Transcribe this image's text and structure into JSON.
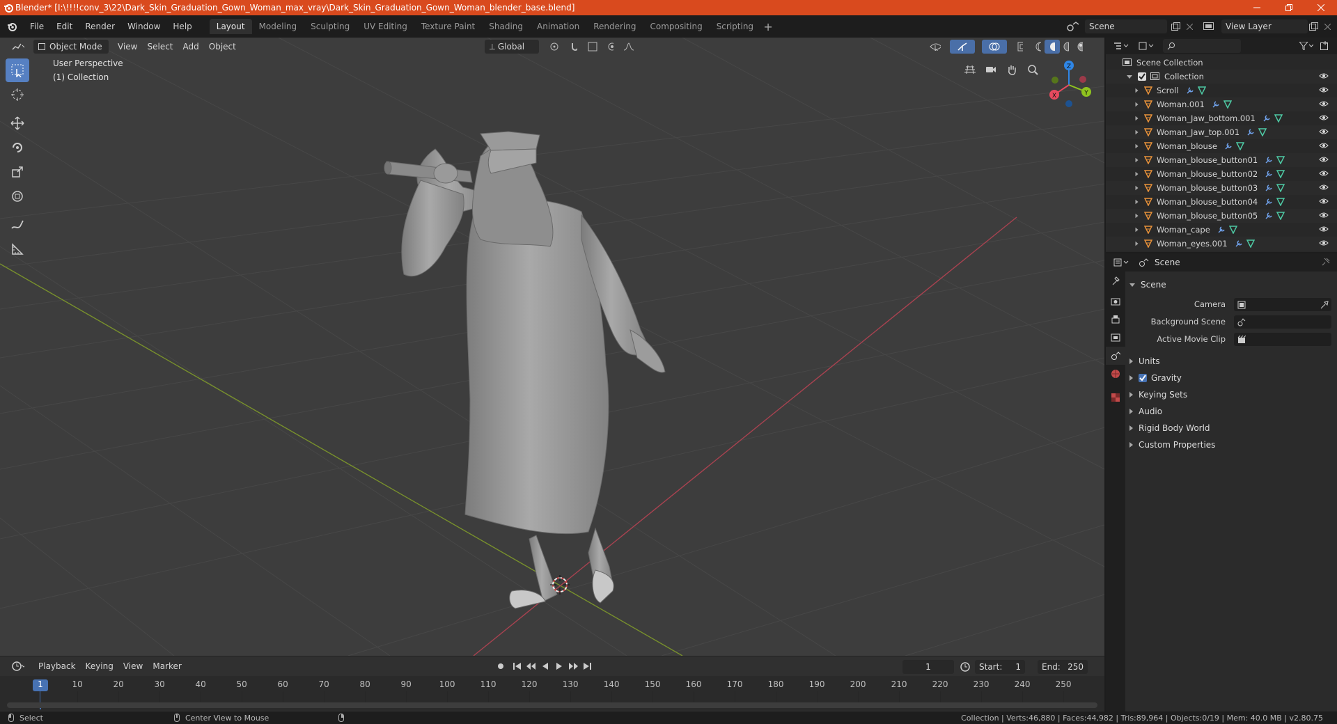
{
  "window": {
    "title": "Blender* [I:\\!!!!conv_3\\22\\Dark_Skin_Graduation_Gown_Woman_max_vray\\Dark_Skin_Graduation_Gown_Woman_blender_base.blend]",
    "accent": "#d94a1e"
  },
  "menu": {
    "items": [
      "File",
      "Edit",
      "Render",
      "Window",
      "Help"
    ]
  },
  "workspaces": {
    "tabs": [
      "Layout",
      "Modeling",
      "Sculpting",
      "UV Editing",
      "Texture Paint",
      "Shading",
      "Animation",
      "Rendering",
      "Compositing",
      "Scripting"
    ],
    "active": "Layout",
    "add_icon": "plus-icon"
  },
  "scene_selector": {
    "value": "Scene"
  },
  "view_layer_selector": {
    "value": "View Layer"
  },
  "viewport": {
    "mode": "Object Mode",
    "menus": [
      "View",
      "Select",
      "Add",
      "Object"
    ],
    "transform_orientation": "Global",
    "perspective_label": "User Perspective",
    "collection_label": "(1) Collection",
    "gizmo_axes": [
      "X",
      "Y",
      "Z"
    ],
    "colors": {
      "x_axis": "#e84a5f",
      "y_axis": "#8fc31f",
      "z_axis": "#2f86e6",
      "grid_bg": "#3d3d3d"
    }
  },
  "timeline": {
    "menus": [
      "Playback",
      "Keying",
      "View",
      "Marker"
    ],
    "current_frame": "1",
    "start_label": "Start:",
    "start_value": "1",
    "end_label": "End:",
    "end_value": "250",
    "ruler": [
      "1",
      "10",
      "20",
      "30",
      "40",
      "50",
      "60",
      "70",
      "80",
      "90",
      "100",
      "110",
      "120",
      "130",
      "140",
      "150",
      "160",
      "170",
      "180",
      "190",
      "200",
      "210",
      "220",
      "230",
      "240",
      "250"
    ]
  },
  "statusbar": {
    "left_action": "Select",
    "middle_action": "Center View to Mouse",
    "stats": "Collection | Verts:46,880 | Faces:44,982 | Tris:89,964 | Objects:0/19 | Mem: 40.0 MB | v2.80.75"
  },
  "outliner": {
    "root": "Scene Collection",
    "collection": "Collection",
    "items": [
      "Scroll",
      "Woman.001",
      "Woman_Jaw_bottom.001",
      "Woman_Jaw_top.001",
      "Woman_blouse",
      "Woman_blouse_button01",
      "Woman_blouse_button02",
      "Woman_blouse_button03",
      "Woman_blouse_button04",
      "Woman_blouse_button05",
      "Woman_cape",
      "Woman_eyes.001"
    ]
  },
  "properties": {
    "context": "Scene",
    "panel_title": "Scene",
    "fields": [
      {
        "label": "Camera"
      },
      {
        "label": "Background Scene"
      },
      {
        "label": "Active Movie Clip"
      }
    ],
    "subpanels": [
      "Units",
      "Gravity",
      "Keying Sets",
      "Audio",
      "Rigid Body World",
      "Custom Properties"
    ],
    "gravity_checked": true
  }
}
